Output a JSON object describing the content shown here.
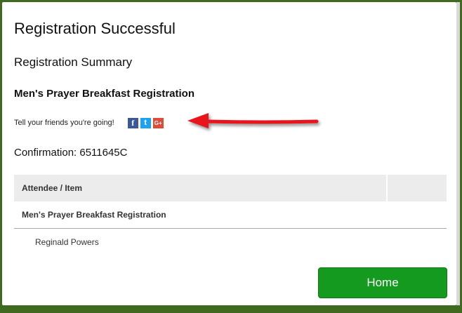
{
  "page": {
    "title": "Registration Successful",
    "summary_heading": "Registration Summary",
    "event_title": "Men's Prayer Breakfast Registration",
    "share_text": "Tell your friends you're going!",
    "social": {
      "facebook": "f",
      "twitter": "t",
      "googleplus": "G+"
    },
    "confirmation": "Confirmation: 6511645C"
  },
  "table": {
    "header": "Attendee / Item",
    "group_row": "Men's Prayer Breakfast Registration",
    "attendee_row": "Reginald Powers"
  },
  "actions": {
    "home_label": "Home"
  },
  "colors": {
    "frame": "#3f6a1f",
    "home_button": "#139a1f",
    "facebook": "#3b5998",
    "twitter": "#1da1f2",
    "googleplus": "#dd4b39",
    "annotation_arrow": "#e8121a"
  }
}
